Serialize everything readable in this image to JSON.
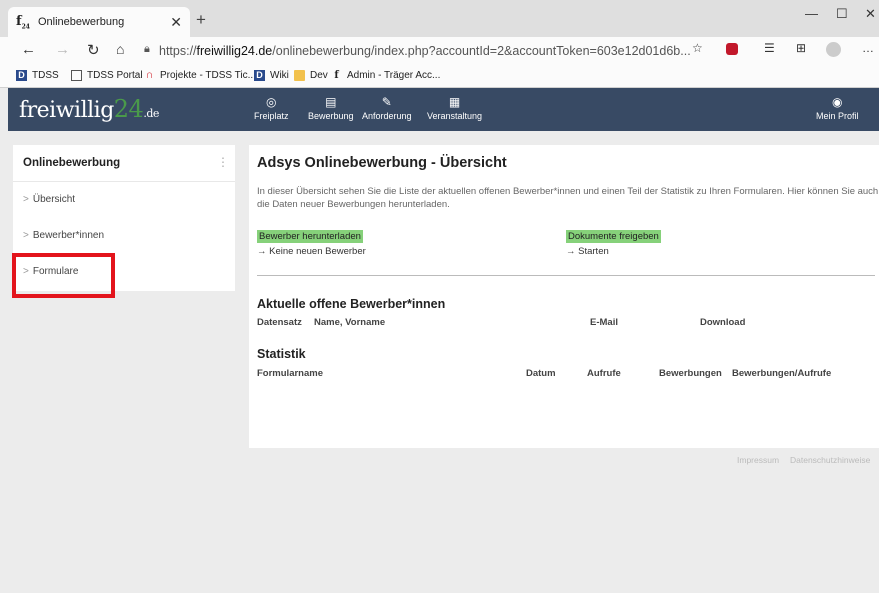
{
  "browser": {
    "tab_title": "Onlinebewerbung",
    "tab_favicon": "f",
    "tab_favicon_sub": "24",
    "new_tab": "+",
    "url_prefix": "https://",
    "url_host": "freiwillig24.de",
    "url_path": "/onlinebewerbung/index.php?accountId=2&accountToken=603e12d01d6b...",
    "bookmarks": [
      "TDSS",
      "TDSS Portal",
      "Projekte - TDSS Tic...",
      "Wiki",
      "Dev",
      "Admin - Träger Acc..."
    ]
  },
  "site": {
    "logo_main": "freiwillig",
    "logo_num": "24",
    "logo_tld": ".de",
    "nav": [
      "Freiplatz",
      "Bewerbung",
      "Anforderung",
      "Veranstaltung"
    ],
    "profile": "Mein Profil"
  },
  "sidebar": {
    "title": "Onlinebewerbung",
    "items": [
      "Übersicht",
      "Bewerber*innen",
      "Formulare"
    ]
  },
  "main": {
    "title": "Adsys Onlinebewerbung - Übersicht",
    "description": "In dieser Übersicht sehen Sie die Liste der aktuellen offenen Bewerber*innen und einen Teil der Statistik zu Ihren Formularen. Hier können Sie auch die Daten neuer Bewerbungen herunterladen.",
    "download_btn": "Bewerber herunterladen",
    "download_note": "→ Keine neuen Bewerber",
    "docs_btn": "Dokumente freigeben",
    "docs_note": "→ Starten",
    "section1": "Aktuelle offene Bewerber*innen",
    "section1_cols": [
      "Datensatz",
      "Name, Vorname",
      "E-Mail",
      "Download"
    ],
    "section2": "Statistik",
    "section2_cols": [
      "Formularname",
      "Datum",
      "Aufrufe",
      "Bewerbungen",
      "Bewerbungen/Aufrufe"
    ]
  },
  "footer": {
    "impressum": "Impressum",
    "datenschutz": "Datenschutzhinweise"
  }
}
